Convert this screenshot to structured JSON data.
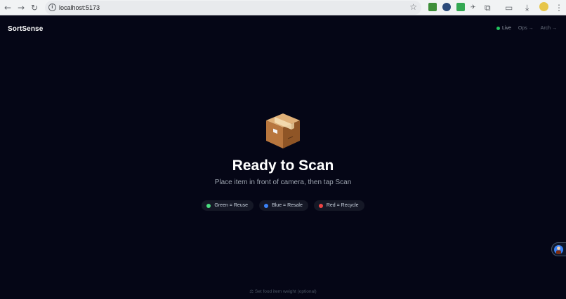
{
  "browser": {
    "url": "localhost:5173"
  },
  "app": {
    "brand": "SortSense",
    "nav": {
      "live": "Live",
      "ops": "Ops →",
      "arch": "Arch →"
    }
  },
  "scan": {
    "title": "Ready to Scan",
    "subtitle": "Place item in front of camera, then tap Scan",
    "icon": "package-box-icon"
  },
  "legend": [
    {
      "label": "Green = Reuse",
      "color": "#4ade80"
    },
    {
      "label": "Blue = Resale",
      "color": "#3b82f6"
    },
    {
      "label": "Red = Recycle",
      "color": "#ef4444"
    }
  ],
  "footer": {
    "weight_link": "Set food item weight (optional)"
  },
  "colors": {
    "background": "#050616",
    "live": "#22c55e"
  }
}
